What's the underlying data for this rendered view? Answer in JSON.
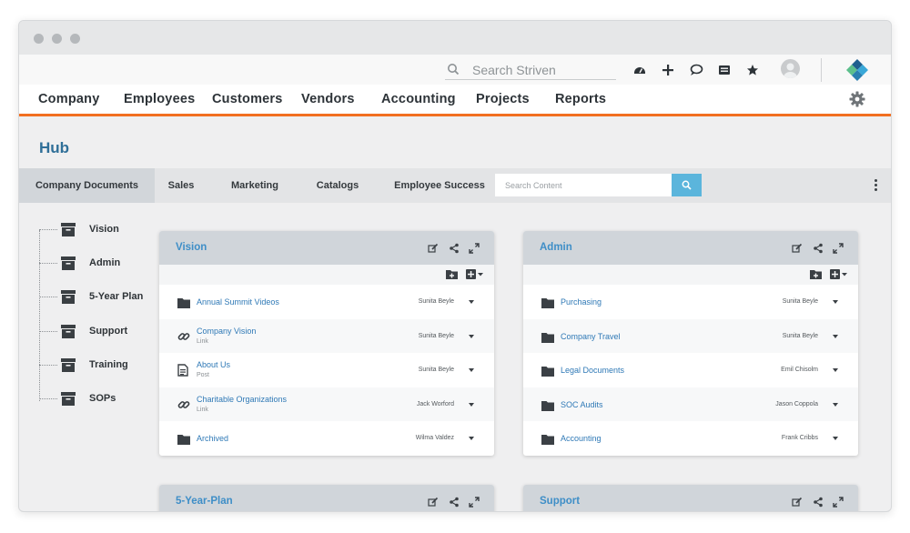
{
  "topbar": {
    "search_placeholder": "Search Striven",
    "icons": [
      "dashboard-icon",
      "plus-icon",
      "chat-icon",
      "inbox-icon",
      "star-icon",
      "avatar-icon",
      "striven-logo"
    ]
  },
  "nav": {
    "items": [
      "Company",
      "Employees",
      "Customers",
      "Vendors",
      "Accounting",
      "Projects",
      "Reports"
    ],
    "accent": "#f26f21"
  },
  "page": {
    "title": "Hub"
  },
  "tabs": {
    "items": [
      "Company Documents",
      "Sales",
      "Marketing",
      "Catalogs",
      "Employee Success"
    ],
    "active": "Company Documents",
    "search_placeholder": "Search Content"
  },
  "tree": {
    "items": [
      "Vision",
      "Admin",
      "5-Year Plan",
      "Support",
      "Training",
      "SOPs"
    ]
  },
  "cards": [
    {
      "title": "Vision",
      "rows": [
        {
          "icon": "folder-icon",
          "name": "Annual Summit Videos",
          "sub": "",
          "owner": "Sunita Beyle"
        },
        {
          "icon": "link-icon",
          "name": "Company Vision",
          "sub": "Link",
          "owner": "Sunita Beyle"
        },
        {
          "icon": "post-icon",
          "name": "About Us",
          "sub": "Post",
          "owner": "Sunita Beyle"
        },
        {
          "icon": "link-icon",
          "name": "Charitable Organizations",
          "sub": "Link",
          "owner": "Jack Worford"
        },
        {
          "icon": "folder-icon",
          "name": "Archived",
          "sub": "",
          "owner": "Wilma Valdez"
        }
      ]
    },
    {
      "title": "Admin",
      "rows": [
        {
          "icon": "folder-icon",
          "name": "Purchasing",
          "sub": "",
          "owner": "Sunita Beyle"
        },
        {
          "icon": "folder-icon",
          "name": "Company Travel",
          "sub": "",
          "owner": "Sunita Beyle"
        },
        {
          "icon": "folder-icon",
          "name": "Legal Documents",
          "sub": "",
          "owner": "Emil Chisolm"
        },
        {
          "icon": "folder-icon",
          "name": "SOC Audits",
          "sub": "",
          "owner": "Jason Coppola"
        },
        {
          "icon": "folder-icon",
          "name": "Accounting",
          "sub": "",
          "owner": "Frank Cribbs"
        }
      ]
    },
    {
      "title": "5-Year-Plan",
      "rows": []
    },
    {
      "title": "Support",
      "rows": []
    }
  ]
}
